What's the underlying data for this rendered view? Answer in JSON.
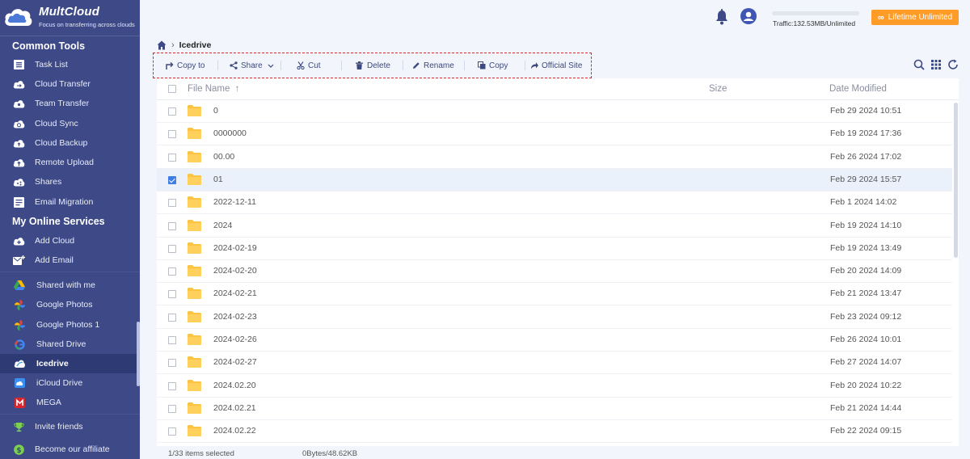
{
  "app": {
    "name": "MultCloud",
    "tagline": "Focus on transferring across clouds"
  },
  "sidebar": {
    "common_tools_title": "Common Tools",
    "common_tools": [
      {
        "label": "Task List",
        "icon": "list-icon"
      },
      {
        "label": "Cloud Transfer",
        "icon": "cloud-transfer-icon"
      },
      {
        "label": "Team Transfer",
        "icon": "team-transfer-icon"
      },
      {
        "label": "Cloud Sync",
        "icon": "cloud-sync-icon"
      },
      {
        "label": "Cloud Backup",
        "icon": "cloud-backup-icon"
      },
      {
        "label": "Remote Upload",
        "icon": "remote-upload-icon"
      },
      {
        "label": "Shares",
        "icon": "shares-icon"
      },
      {
        "label": "Email Migration",
        "icon": "email-migration-icon"
      }
    ],
    "online_services_title": "My Online Services",
    "add_items": [
      {
        "label": "Add Cloud",
        "icon": "add-cloud-icon"
      },
      {
        "label": "Add Email",
        "icon": "add-email-icon"
      }
    ],
    "services": [
      {
        "label": "Shared with me",
        "icon": "google-drive-icon"
      },
      {
        "label": "Google Photos",
        "icon": "google-photos-icon"
      },
      {
        "label": "Google Photos 1",
        "icon": "google-photos-icon"
      },
      {
        "label": "Shared Drive",
        "icon": "google-icon"
      },
      {
        "label": "Icedrive",
        "icon": "icedrive-icon",
        "active": true
      },
      {
        "label": "iCloud Drive",
        "icon": "icloud-icon"
      },
      {
        "label": "MEGA",
        "icon": "mega-icon"
      }
    ],
    "footer_items": [
      {
        "label": "Invite friends",
        "icon": "trophy-icon"
      },
      {
        "label": "Become our affiliate",
        "icon": "dollar-icon"
      }
    ]
  },
  "topbar": {
    "traffic": "Traffic:132.53MB/Unlimited",
    "lifetime_label": "Lifetime Unlimited",
    "colors": {
      "accent": "#ff9c27",
      "sidebar": "#3d4a87"
    }
  },
  "breadcrumb": {
    "current": "Icedrive"
  },
  "toolbar": {
    "copy_to": "Copy to",
    "share": "Share",
    "cut": "Cut",
    "delete": "Delete",
    "rename": "Rename",
    "copy": "Copy",
    "official_site": "Official Site"
  },
  "table": {
    "col_name": "File Name",
    "col_size": "Size",
    "col_date": "Date Modified",
    "sort_indicator": "↑",
    "rows": [
      {
        "name": "0",
        "date": "Feb 29 2024 10:51",
        "selected": false
      },
      {
        "name": "0000000",
        "date": "Feb 19 2024 17:36",
        "selected": false
      },
      {
        "name": "00.00",
        "date": "Feb 26 2024 17:02",
        "selected": false
      },
      {
        "name": "01",
        "date": "Feb 29 2024 15:57",
        "selected": true
      },
      {
        "name": "2022-12-11",
        "date": "Feb 1 2024 14:02",
        "selected": false
      },
      {
        "name": "2024",
        "date": "Feb 19 2024 14:10",
        "selected": false
      },
      {
        "name": "2024-02-19",
        "date": "Feb 19 2024 13:49",
        "selected": false
      },
      {
        "name": "2024-02-20",
        "date": "Feb 20 2024 14:09",
        "selected": false
      },
      {
        "name": "2024-02-21",
        "date": "Feb 21 2024 13:47",
        "selected": false
      },
      {
        "name": "2024-02-23",
        "date": "Feb 23 2024 09:12",
        "selected": false
      },
      {
        "name": "2024-02-26",
        "date": "Feb 26 2024 10:01",
        "selected": false
      },
      {
        "name": "2024-02-27",
        "date": "Feb 27 2024 14:07",
        "selected": false
      },
      {
        "name": "2024.02.20",
        "date": "Feb 20 2024 10:22",
        "selected": false
      },
      {
        "name": "2024.02.21",
        "date": "Feb 21 2024 14:44",
        "selected": false
      },
      {
        "name": "2024.02.22",
        "date": "Feb 22 2024 09:15",
        "selected": false
      }
    ]
  },
  "status": {
    "selected": "1/33 items selected",
    "size": "0Bytes/48.62KB"
  }
}
